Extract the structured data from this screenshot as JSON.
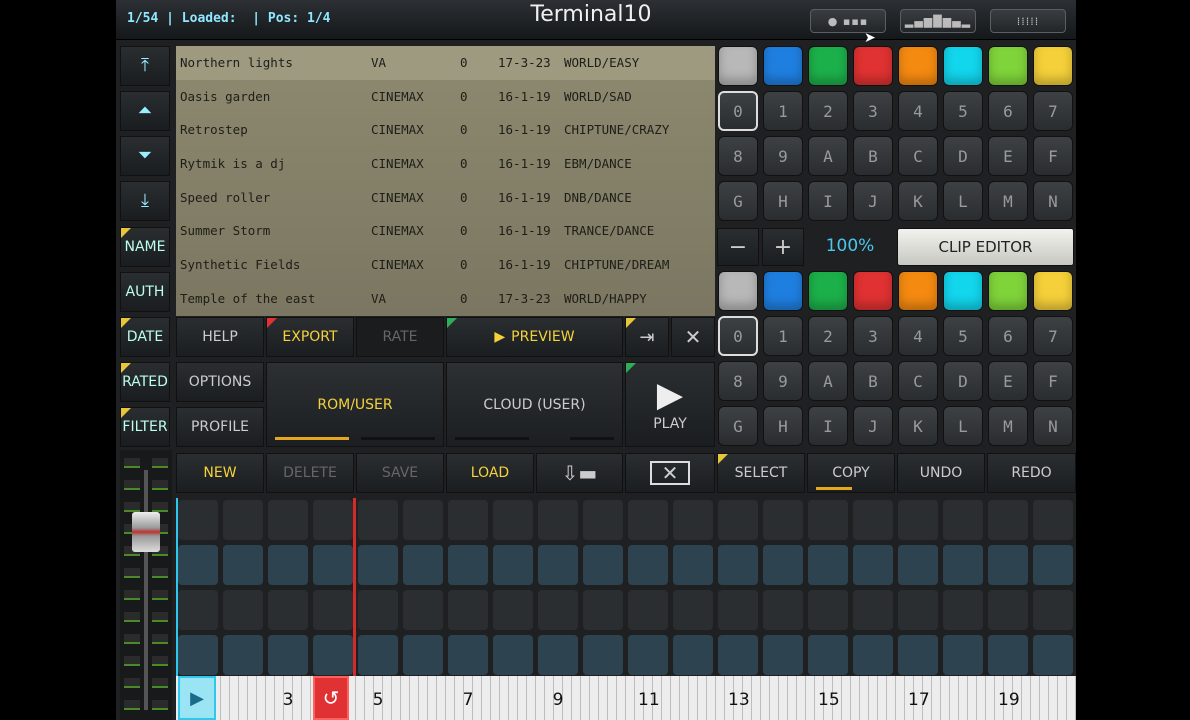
{
  "status": {
    "text": "1/54 | Loaded:  | Pos: 1/4"
  },
  "app": {
    "title": "Terminal10"
  },
  "top_buttons": [
    {
      "icon": "pattern-dots-icon"
    },
    {
      "icon": "waveform-icon"
    },
    {
      "icon": "keyboard-icon"
    }
  ],
  "songs": [
    {
      "name": "Northern lights",
      "author": "VA",
      "rating": "0",
      "date": "17-3-23",
      "genre": "WORLD/EASY"
    },
    {
      "name": "Oasis garden",
      "author": "CINEMAX",
      "rating": "0",
      "date": "16-1-19",
      "genre": "WORLD/SAD"
    },
    {
      "name": "Retrostep",
      "author": "CINEMAX",
      "rating": "0",
      "date": "16-1-19",
      "genre": "CHIPTUNE/CRAZY"
    },
    {
      "name": "Rytmik is a dj",
      "author": "CINEMAX",
      "rating": "0",
      "date": "16-1-19",
      "genre": "EBM/DANCE"
    },
    {
      "name": "Speed roller",
      "author": "CINEMAX",
      "rating": "0",
      "date": "16-1-19",
      "genre": "DNB/DANCE"
    },
    {
      "name": "Summer Storm",
      "author": "CINEMAX",
      "rating": "0",
      "date": "16-1-19",
      "genre": "TRANCE/DANCE"
    },
    {
      "name": "Synthetic Fields",
      "author": "CINEMAX",
      "rating": "0",
      "date": "16-1-19",
      "genre": "CHIPTUNE/DREAM"
    },
    {
      "name": "Temple of the east",
      "author": "VA",
      "rating": "0",
      "date": "17-3-23",
      "genre": "WORLD/HAPPY"
    }
  ],
  "sort": {
    "name": "NAME",
    "auth": "AUTH",
    "date": "DATE",
    "rated": "RATED",
    "filter": "FILTER"
  },
  "actions": {
    "help": "HELP",
    "export": "EXPORT",
    "rate": "RATE",
    "preview": "PREVIEW",
    "options": "OPTIONS",
    "profile": "PROFILE",
    "rom_user": "ROM/USER",
    "cloud_user": "CLOUD (USER)",
    "play": "PLAY"
  },
  "bottom": {
    "new": "NEW",
    "delete": "DELETE",
    "save": "SAVE",
    "load": "LOAD",
    "select": "SELECT",
    "copy": "COPY",
    "undo": "UNDO",
    "redo": "REDO"
  },
  "clip": {
    "zoom": "100%",
    "editor": "CLIP EDITOR",
    "minus": "−",
    "plus": "+"
  },
  "pad_colors": [
    "#b8b8b8",
    "#1f7fe0",
    "#1cb04a",
    "#e03232",
    "#f58a10",
    "#12d6ec",
    "#7fd43a",
    "#f5d03a"
  ],
  "pad_labels": [
    "0",
    "1",
    "2",
    "3",
    "4",
    "5",
    "6",
    "7",
    "8",
    "9",
    "A",
    "B",
    "C",
    "D",
    "E",
    "F",
    "G",
    "H",
    "I",
    "J",
    "K",
    "L",
    "M",
    "N"
  ],
  "timeline": {
    "numbers": [
      "3",
      "5",
      "7",
      "9",
      "11",
      "13",
      "15",
      "17",
      "19"
    ],
    "playhead_icon": "play-marker-icon",
    "loop_icon": "loop-return-icon"
  }
}
